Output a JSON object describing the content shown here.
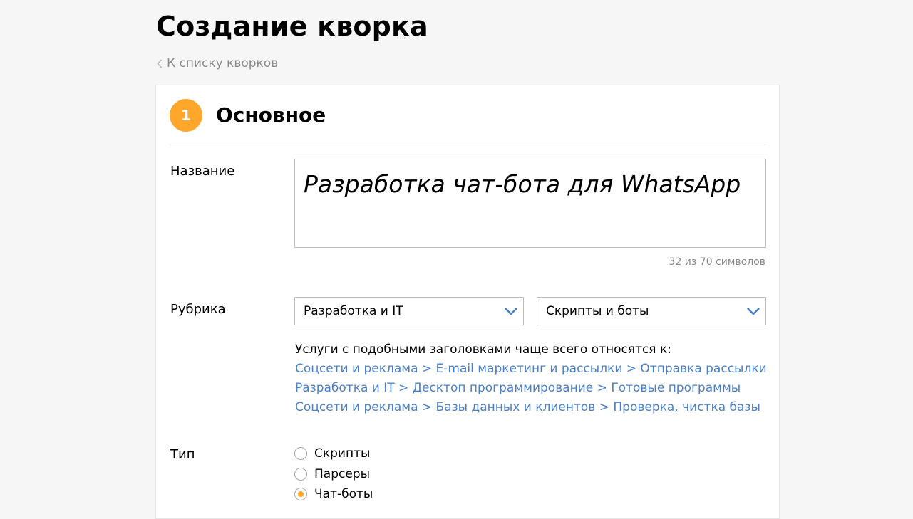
{
  "header": {
    "title": "Создание кворка",
    "back_link": "К списку кворков"
  },
  "section": {
    "step_number": "1",
    "title": "Основное"
  },
  "name_field": {
    "label": "Название",
    "value": "Разработка чат-бота для WhatsApp",
    "counter": "32 из 70 символов"
  },
  "rubric": {
    "label": "Рубрика",
    "category": "Разработка и IT",
    "subcategory": "Скрипты и боты",
    "suggestions_heading": "Услуги с подобными заголовками чаще всего относятся к:",
    "suggestions": [
      "Соцсети и реклама > E-mail маркетинг и рассылки > Отправка рассылки",
      "Разработка и IT > Десктоп программирование > Готовые программы",
      "Соцсети и реклама > Базы данных и клиентов > Проверка, чистка базы"
    ]
  },
  "type_field": {
    "label": "Тип",
    "options": [
      {
        "label": "Скрипты",
        "selected": false
      },
      {
        "label": "Парсеры",
        "selected": false
      },
      {
        "label": "Чат-боты",
        "selected": true
      }
    ]
  },
  "colors": {
    "accent": "#ffa72a",
    "link": "#4a80c8",
    "muted_text": "#8a8a8a",
    "chevron": "#4a80c8"
  },
  "icons": {
    "back": "chevron-left-icon",
    "dropdown": "chevron-down-icon"
  }
}
